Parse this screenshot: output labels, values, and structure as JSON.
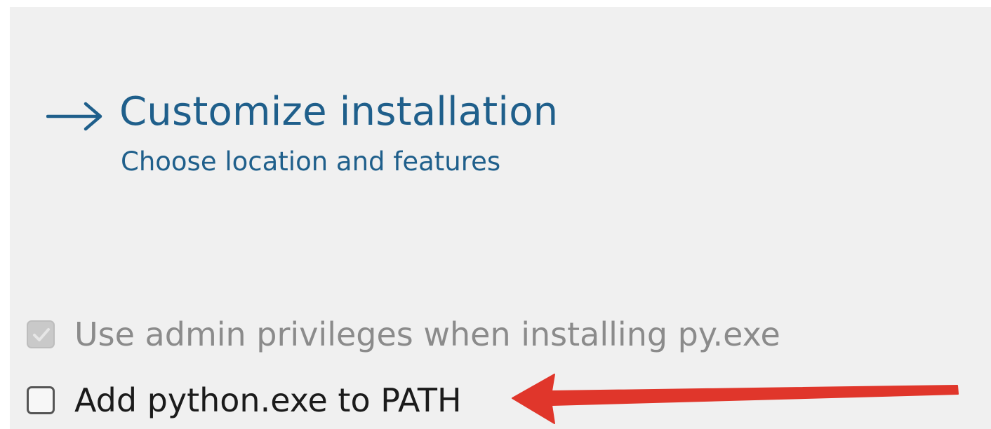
{
  "installer": {
    "customize": {
      "title": "Customize installation",
      "subtitle": "Choose location and features",
      "icon": "right-arrow-icon",
      "color": "#1f5f8b"
    },
    "options": {
      "admin_privileges": {
        "label": "Use admin privileges when installing py.exe",
        "checked": true,
        "enabled": false
      },
      "add_to_path": {
        "label": "Add python.exe to PATH",
        "checked": false,
        "enabled": true
      }
    }
  },
  "annotation": {
    "icon": "red-arrow-icon",
    "color": "#e0362b"
  },
  "colors": {
    "background": "#f0f0f0",
    "link": "#1f5f8b",
    "disabled_text": "#8b8b8b",
    "text": "#1b1b1b"
  }
}
